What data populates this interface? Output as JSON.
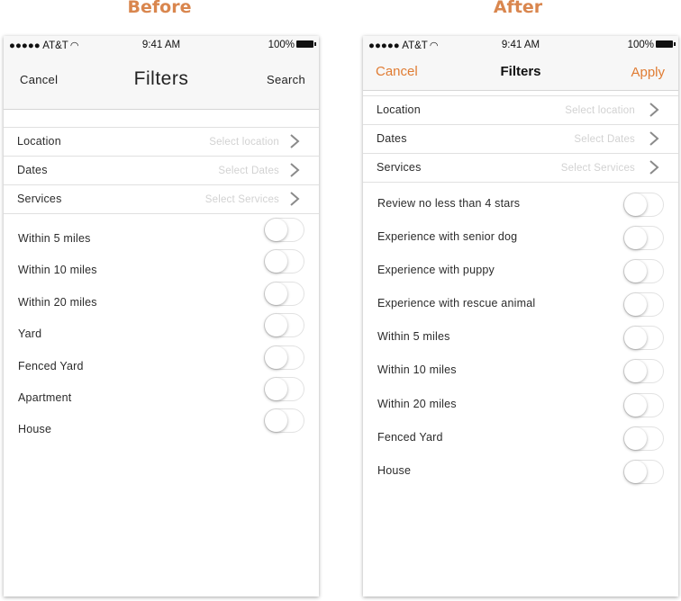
{
  "headings": {
    "before": "Before",
    "after": "After"
  },
  "colors": {
    "accent": "#e07c33",
    "heading": "#d9864e"
  },
  "status_bar": {
    "carrier": "●●●●● AT&T",
    "wifi_icon": "wifi-icon",
    "time": "9:41 AM",
    "battery": "100%"
  },
  "before": {
    "nav": {
      "left": "Cancel",
      "title": "Filters",
      "right": "Search"
    },
    "selects": [
      {
        "label": "Location",
        "hint": "Select location"
      },
      {
        "label": "Dates",
        "hint": "Select Dates"
      },
      {
        "label": "Services",
        "hint": "Select Services"
      }
    ],
    "toggles": [
      {
        "label": "Within 5 miles",
        "on": false
      },
      {
        "label": "Within 10 miles",
        "on": false
      },
      {
        "label": "Within 20 miles",
        "on": false
      },
      {
        "label": "Yard",
        "on": false
      },
      {
        "label": "Fenced Yard",
        "on": false
      },
      {
        "label": "Apartment",
        "on": false
      },
      {
        "label": "House",
        "on": false
      }
    ]
  },
  "after": {
    "nav": {
      "left": "Cancel",
      "title": "Filters",
      "right": "Apply"
    },
    "selects": [
      {
        "label": "Location",
        "hint": "Select location"
      },
      {
        "label": "Dates",
        "hint": "Select Dates"
      },
      {
        "label": "Services",
        "hint": "Select Services"
      }
    ],
    "toggles": [
      {
        "label": "Review no less than 4 stars",
        "on": false
      },
      {
        "label": "Experience with senior dog",
        "on": false
      },
      {
        "label": "Experience with puppy",
        "on": false
      },
      {
        "label": "Experience with rescue animal",
        "on": false
      },
      {
        "label": "Within 5 miles",
        "on": false
      },
      {
        "label": "Within 10 miles",
        "on": false
      },
      {
        "label": "Within 20 miles",
        "on": false
      },
      {
        "label": "Fenced Yard",
        "on": false
      },
      {
        "label": "House",
        "on": false
      }
    ]
  }
}
